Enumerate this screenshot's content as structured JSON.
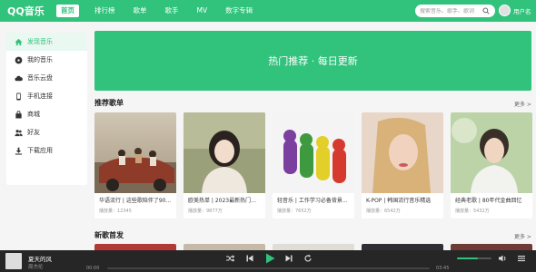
{
  "app": {
    "logo": "QQ音乐"
  },
  "nav": {
    "items": [
      "首页",
      "排行榜",
      "歌单",
      "歌手",
      "MV",
      "数字专辑"
    ],
    "active_index": 0
  },
  "search": {
    "placeholder": "搜索音乐、歌手、歌词"
  },
  "user": {
    "name": "用户名"
  },
  "sidebar": {
    "items": [
      {
        "label": "发现音乐",
        "icon": "home-icon",
        "active": true
      },
      {
        "label": "我的音乐",
        "icon": "music-disc-icon"
      },
      {
        "label": "音乐云盘",
        "icon": "cloud-icon"
      },
      {
        "label": "手机连接",
        "icon": "phone-icon"
      },
      {
        "label": "商城",
        "icon": "bag-icon"
      },
      {
        "label": "好友",
        "icon": "friends-icon"
      },
      {
        "label": "下载应用",
        "icon": "download-icon"
      }
    ]
  },
  "hero": {
    "text": "热门推荐 · 每日更新"
  },
  "recommended": {
    "title": "推荐歌单",
    "more": "更多 >",
    "cards": [
      {
        "title": "华语流行 | 这些歌陪伴了90...",
        "plays": "播放量：12345"
      },
      {
        "title": "欧美热单 | 2023最新热门歌...",
        "plays": "播放量：9877万"
      },
      {
        "title": "轻音乐 | 工作学习必备背景...",
        "plays": "播放量：7652万"
      },
      {
        "title": "K-POP | 韩国流行音乐精选",
        "plays": "播放量：6542万"
      },
      {
        "title": "经典老歌 | 80年代金曲回忆",
        "plays": "播放量：5432万"
      }
    ]
  },
  "new_songs": {
    "title": "新歌首发",
    "more": "更多 >"
  },
  "player": {
    "title": "夏天的风",
    "artist": "周杰伦",
    "current_time": "00:00",
    "total_time": "03:45",
    "progress": 0.0,
    "volume": 0.6
  },
  "colors": {
    "brand": "#31c27c",
    "player_bg": "#262626"
  }
}
